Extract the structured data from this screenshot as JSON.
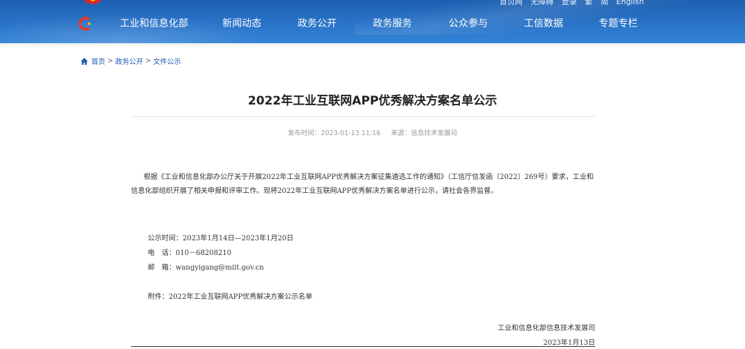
{
  "header": {
    "top_links": [
      "首页网",
      "无障碍",
      "登录",
      "繁",
      "简",
      "English"
    ],
    "nav": [
      {
        "label": "工业和信息化部"
      },
      {
        "label": "新闻动态"
      },
      {
        "label": "政务公开"
      },
      {
        "label": "政务服务"
      },
      {
        "label": "公众参与"
      },
      {
        "label": "工信数据"
      },
      {
        "label": "专题专栏"
      }
    ]
  },
  "breadcrumb": {
    "home": "首页",
    "level1": "政务公开",
    "level2": "文件公示",
    "separator": ">"
  },
  "article": {
    "title": "2022年工业互联网APP优秀解决方案名单公示",
    "publish_time": "发布时间：2023-01-13 11:16",
    "source": "来源：信息技术发展司",
    "paragraph": "根据《工业和信息化部办公厅关于开展2022年工业互联网APP优秀解决方案征集遴选工作的通知》（工信厅信发函〔2022〕269号）要求，工业和信息化部组织开展了相关申报和评审工作。现将2022年工业互联网APP优秀解决方案名单进行公示，请社会各界监督。",
    "notice_period": "公示时间：2023年1月14日—2023年1月20日",
    "phone": "电　话：010－68208210",
    "email": "邮　箱：wangyigang@miit.gov.cn",
    "attachment": "附件：2022年工业互联网APP优秀解决方案公示名单",
    "signature_org": "工业和信息化部信息技术发展司",
    "signature_date": "2023年1月13日"
  }
}
